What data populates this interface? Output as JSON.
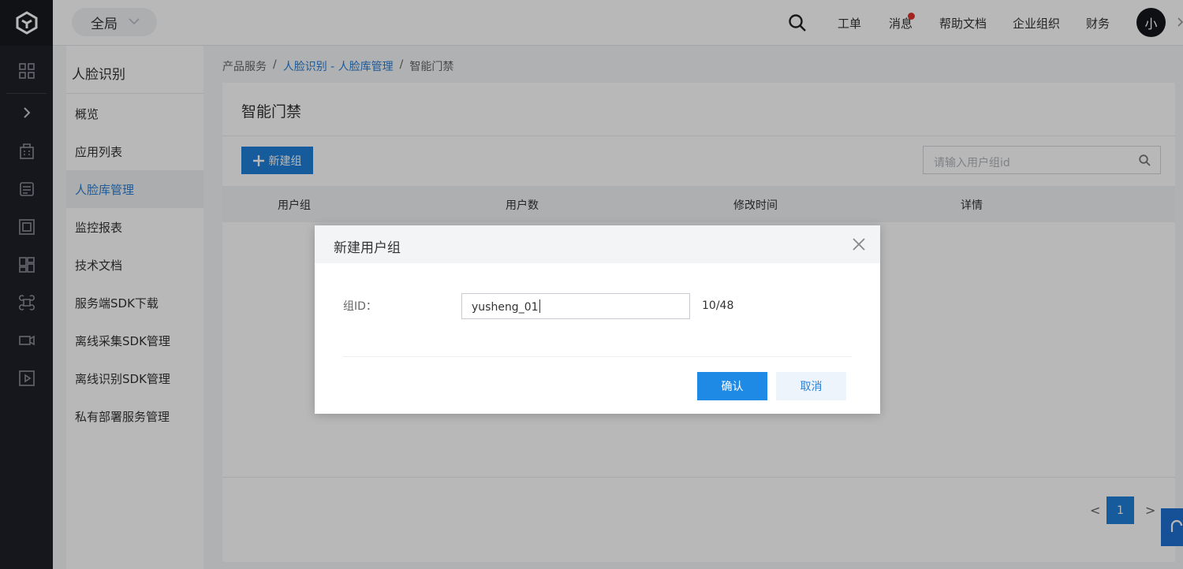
{
  "header": {
    "scope_label": "全局",
    "nav": [
      {
        "label": "工单"
      },
      {
        "label": "消息"
      },
      {
        "label": "帮助文档"
      },
      {
        "label": "企业组织"
      },
      {
        "label": "财务"
      }
    ],
    "avatar_text": "小"
  },
  "sidebar": {
    "title": "人脸识别",
    "items": [
      {
        "label": "概览"
      },
      {
        "label": "应用列表"
      },
      {
        "label": "人脸库管理"
      },
      {
        "label": "监控报表"
      },
      {
        "label": "技术文档"
      },
      {
        "label": "服务端SDK下载"
      },
      {
        "label": "离线采集SDK管理"
      },
      {
        "label": "离线识别SDK管理"
      },
      {
        "label": "私有部署服务管理"
      }
    ]
  },
  "breadcrumb": {
    "items": [
      "产品服务",
      "人脸识别 - 人脸库管理",
      "智能门禁"
    ],
    "separator": "/"
  },
  "main": {
    "title": "智能门禁",
    "new_button_label": "新建组",
    "search_placeholder": "请输入用户组id",
    "columns": [
      "用户组",
      "用户数",
      "修改时间",
      "详情"
    ],
    "pagination": {
      "prev": "<",
      "current": "1",
      "next": ">"
    }
  },
  "modal": {
    "title": "新建用户组",
    "field_label": "组ID：",
    "field_value": "yusheng_01",
    "char_count": "10/48",
    "confirm_label": "确认",
    "cancel_label": "取消"
  },
  "colors": {
    "primary": "#1f7fd8",
    "link": "#2a7fd4",
    "rail_bg": "#1e2128",
    "badge": "#e0342c"
  }
}
